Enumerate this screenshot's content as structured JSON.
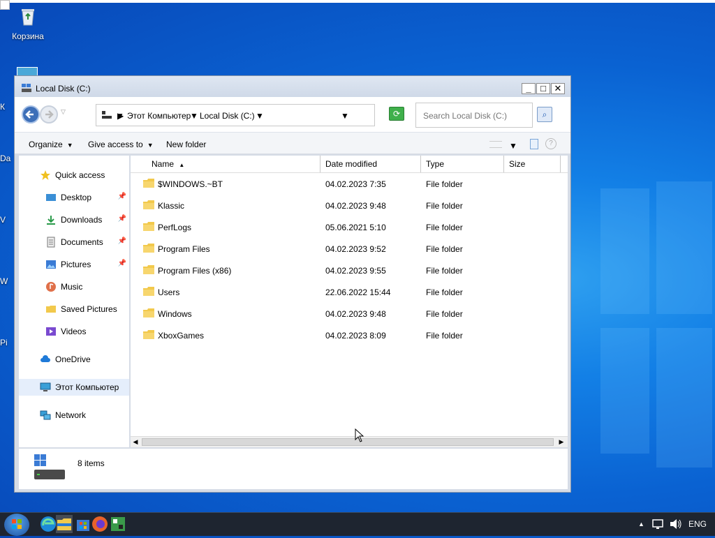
{
  "desktop": {
    "recycle_bin_label": "Корзина",
    "edge_labels": [
      "К",
      "Da",
      "V",
      "W",
      "Pi"
    ]
  },
  "window": {
    "title": "Local Disk (C:)",
    "minimize": "_",
    "maximize": "□",
    "close": "✕"
  },
  "address": {
    "crumbs": [
      "Этот Компьютер",
      "Local Disk (C:)"
    ]
  },
  "search": {
    "placeholder": "Search Local Disk (C:)"
  },
  "commands": {
    "organize": "Organize",
    "give_access": "Give access to",
    "new_folder": "New folder"
  },
  "sidebar": {
    "items": [
      {
        "label": "Quick access",
        "icon": "star-icon"
      },
      {
        "label": "Desktop",
        "icon": "desktop-icon",
        "pinned": true
      },
      {
        "label": "Downloads",
        "icon": "download-icon",
        "pinned": true
      },
      {
        "label": "Documents",
        "icon": "documents-icon",
        "pinned": true
      },
      {
        "label": "Pictures",
        "icon": "pictures-icon",
        "pinned": true
      },
      {
        "label": "Music",
        "icon": "music-icon"
      },
      {
        "label": "Saved Pictures",
        "icon": "folder-icon"
      },
      {
        "label": "Videos",
        "icon": "videos-icon"
      },
      {
        "label": "OneDrive",
        "icon": "cloud-icon"
      },
      {
        "label": "Этот Компьютер",
        "icon": "computer-icon",
        "selected": true
      },
      {
        "label": "Network",
        "icon": "network-icon"
      }
    ]
  },
  "columns": {
    "name": "Name",
    "date": "Date modified",
    "type": "Type",
    "size": "Size"
  },
  "files": [
    {
      "name": "$WINDOWS.~BT",
      "date": "04.02.2023 7:35",
      "type": "File folder"
    },
    {
      "name": "Klassic",
      "date": "04.02.2023 9:48",
      "type": "File folder"
    },
    {
      "name": "PerfLogs",
      "date": "05.06.2021 5:10",
      "type": "File folder"
    },
    {
      "name": "Program Files",
      "date": "04.02.2023 9:52",
      "type": "File folder"
    },
    {
      "name": "Program Files (x86)",
      "date": "04.02.2023 9:55",
      "type": "File folder"
    },
    {
      "name": "Users",
      "date": "22.06.2022 15:44",
      "type": "File folder"
    },
    {
      "name": "Windows",
      "date": "04.02.2023 9:48",
      "type": "File folder"
    },
    {
      "name": "XboxGames",
      "date": "04.02.2023 8:09",
      "type": "File folder"
    }
  ],
  "status": {
    "items": "8 items"
  },
  "taskbar": {
    "language": "ENG"
  },
  "colors": {
    "folder": "#f2c94c",
    "selection": "#e5eefb",
    "taskbar": "#1e2530"
  }
}
